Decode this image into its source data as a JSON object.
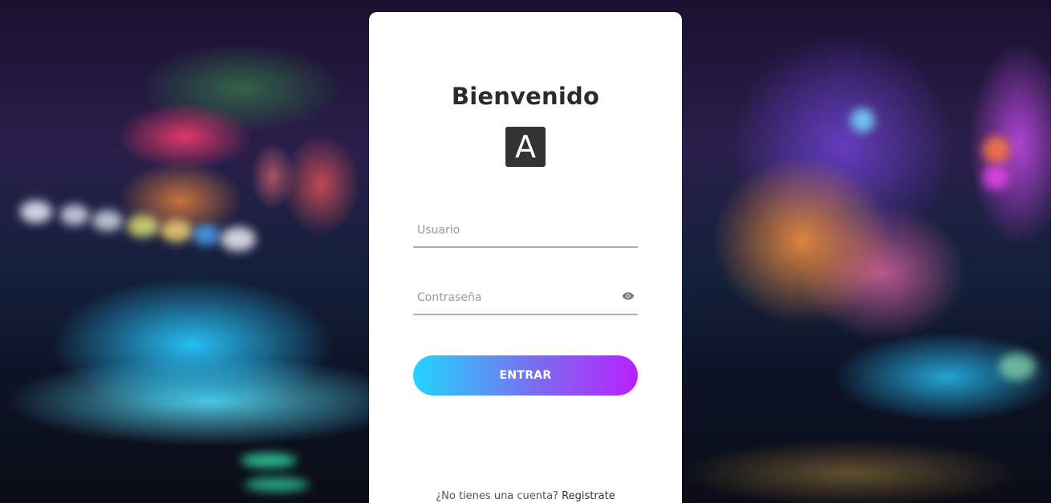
{
  "login": {
    "title": "Bienvenido",
    "logo_letter": "A",
    "username_placeholder": "Usuario",
    "password_placeholder": "Contraseña",
    "submit_label": "ENTRAR",
    "signup_prompt": "¿No tienes una cuenta?",
    "signup_link": "Registrate"
  },
  "icons": {
    "password_toggle": "eye-icon"
  },
  "colors": {
    "button_gradient_start": "#21d4fd",
    "button_gradient_end": "#b721ff",
    "title": "#2b2b2b",
    "logo_bg": "#333333"
  }
}
